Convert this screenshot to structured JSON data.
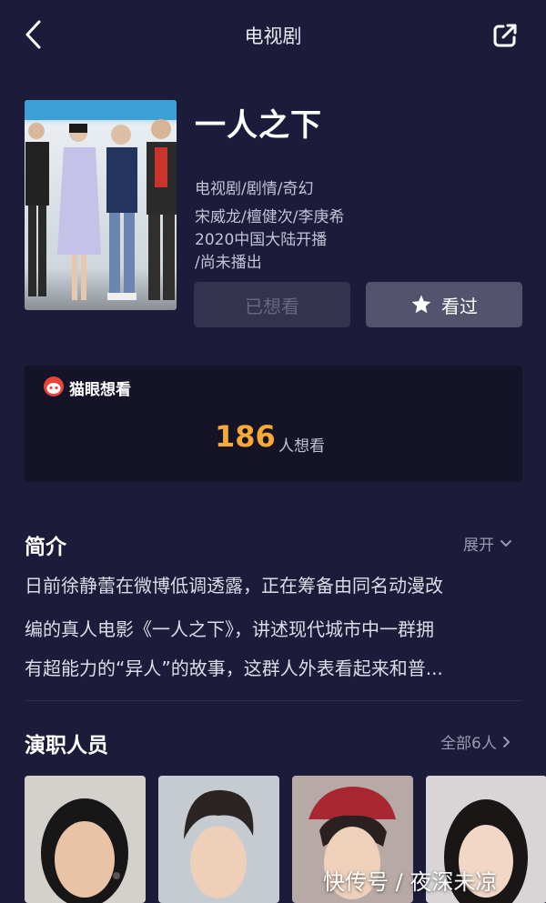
{
  "header": {
    "title": "电视剧"
  },
  "movie": {
    "title": "一人之下",
    "genre": "电视剧/剧情/奇幻",
    "cast_line": "宋威龙/檀健次/李庚希",
    "release_line": "2020中国大陆开播",
    "status_line": "/尚未播出"
  },
  "actions": {
    "wanted_label": "已想看",
    "seen_label": "看过"
  },
  "want": {
    "label": "猫眼想看",
    "count": "186",
    "suffix": "人想看"
  },
  "intro": {
    "title": "简介",
    "expand_label": "展开",
    "lines": [
      "日前徐静蕾在微博低调透露，正在筹备由同名动漫改",
      "编的真人电影《一人之下》，讲述现代城市中一群拥",
      "有超能力的“异人”的故事，这群人外表看起来和普..."
    ]
  },
  "cast": {
    "title": "演职人员",
    "all_label": "全部6人"
  },
  "watermark": "快传号 / 夜深未凉",
  "colors": {
    "background": "#1c1b3a",
    "accent": "#f7a935",
    "card": "#141327"
  }
}
